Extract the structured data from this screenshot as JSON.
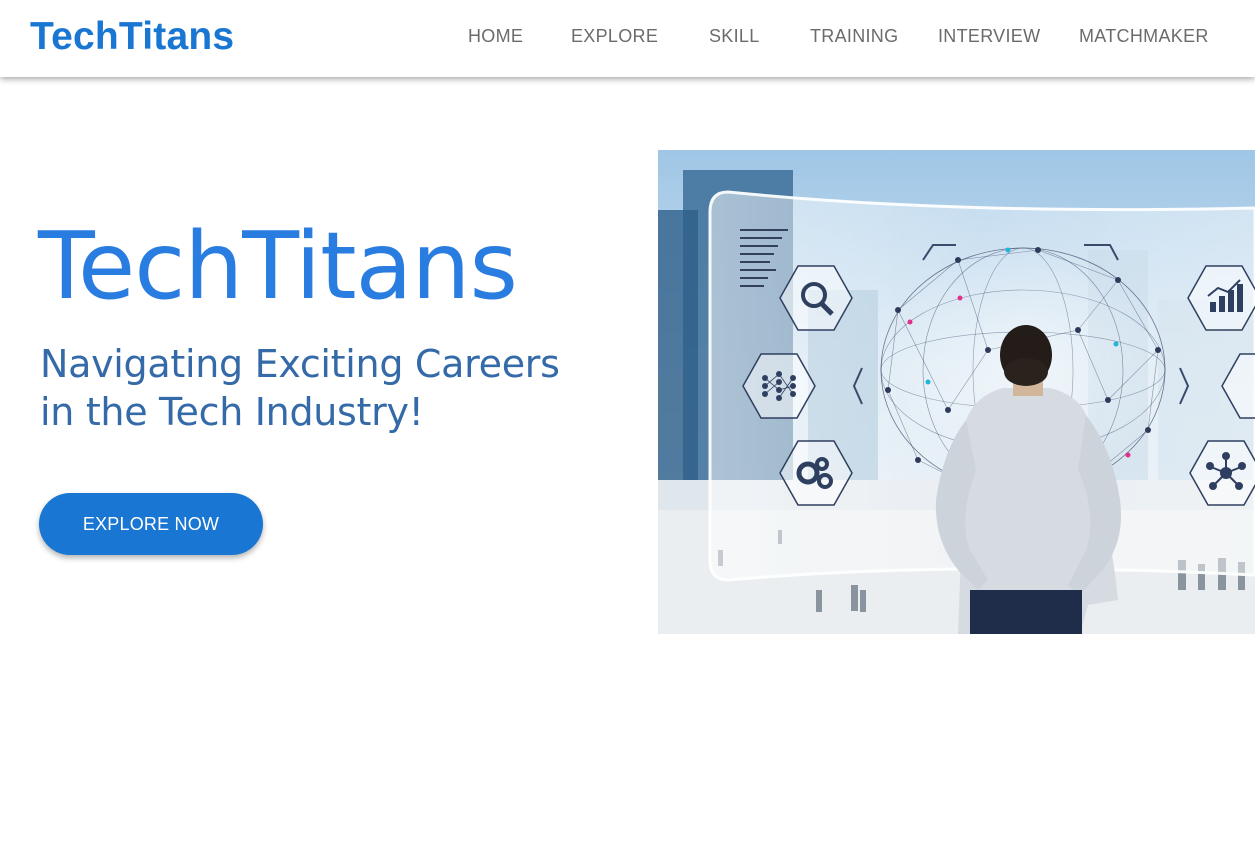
{
  "navbar": {
    "brand": "TechTitans",
    "links": [
      "HOME",
      "EXPLORE",
      "SKILL",
      "TRAINING",
      "INTERVIEW",
      "MATCHMAKER"
    ]
  },
  "hero": {
    "title": "TechTitans",
    "subtitle_line1": "Navigating Exciting Careers",
    "subtitle_line2": "in the Tech Industry!",
    "cta_label": "EXPLORE NOW"
  },
  "colors": {
    "brand": "#1976d2",
    "title": "#2a7de0",
    "subtitle": "#356aa8",
    "nav_text": "#6b6b6b"
  },
  "icons": [
    "search-analytics-icon",
    "neural-network-icon",
    "gears-icon",
    "bar-chart-icon",
    "network-nodes-icon",
    "chevron-left-icon",
    "chevron-right-icon"
  ]
}
